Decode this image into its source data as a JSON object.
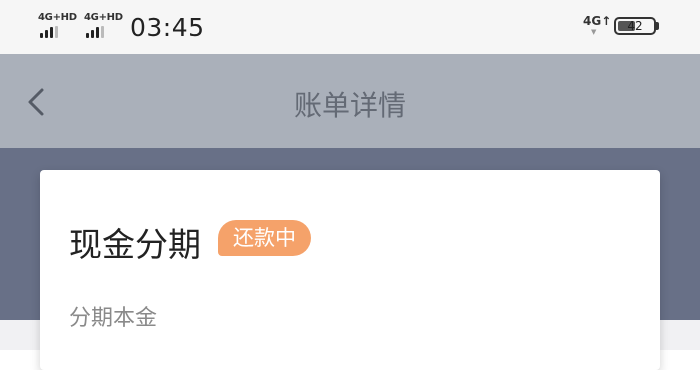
{
  "status_bar": {
    "sim1_network": "4G+HD",
    "sim2_network": "4G+HD",
    "time": "03:45",
    "data_network": "4G",
    "battery_level": "42"
  },
  "nav": {
    "title": "账单详情",
    "back_icon": "chevron-left-icon"
  },
  "card": {
    "title": "现金分期",
    "status_badge": "还款中",
    "first_field_label": "分期本金"
  },
  "colors": {
    "nav_bg": "#aab0ba",
    "header_bg": "#687087",
    "badge_bg": "#f5a26a"
  }
}
